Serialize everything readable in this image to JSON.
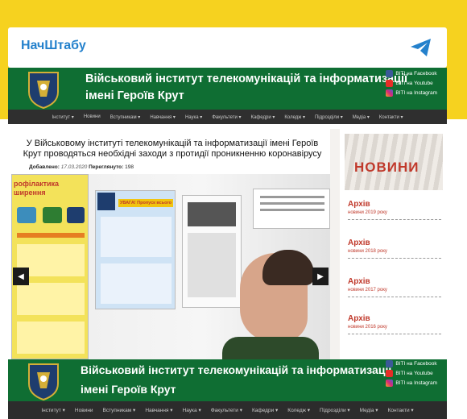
{
  "channel": {
    "name": "НачШтабу"
  },
  "site": {
    "title_line1": "Військовий інститут телекомунікацій та інформатизації",
    "title_line2": "імені Героїв Крут",
    "social": [
      "ВІТІ на Facebook",
      "ВІТІ на Youtube",
      "ВІТІ на Instagram"
    ]
  },
  "nav": [
    "Інститут ▾",
    "Новини",
    "Вступникам ▾",
    "Навчання ▾",
    "Наука ▾",
    "Факультети ▾",
    "Кафедри ▾",
    "Коледж ▾",
    "Підрозділи ▾",
    "Медіа ▾",
    "Контакти ▾"
  ],
  "article": {
    "title": "У Військовому інституті телекомунікацій та інформатизації імені Героїв Крут проводяться необхідні заходи з протидії проникненню коронавірусу",
    "added_label": "Добавлено:",
    "added_value": "17.03.2020",
    "views_label": "Переглянуто:",
    "views_value": "198",
    "poster_text_1": "рофілактика\nширення",
    "poster_text_2": "УВАГА! Пропуск всього"
  },
  "sidebar": {
    "news_label": "НОВИНИ",
    "archive": [
      {
        "title": "Архів",
        "sub": "новини 2019 року"
      },
      {
        "title": "Архів",
        "sub": "новини 2018 року"
      },
      {
        "title": "Архів",
        "sub": "новини 2017 року"
      },
      {
        "title": "Архів",
        "sub": "новини 2016 року"
      }
    ]
  },
  "colors": {
    "accent_yellow": "#f6d21f",
    "telegram_blue": "#2481cc",
    "banner_green": "#0f6e33",
    "archive_red": "#c0392b"
  }
}
